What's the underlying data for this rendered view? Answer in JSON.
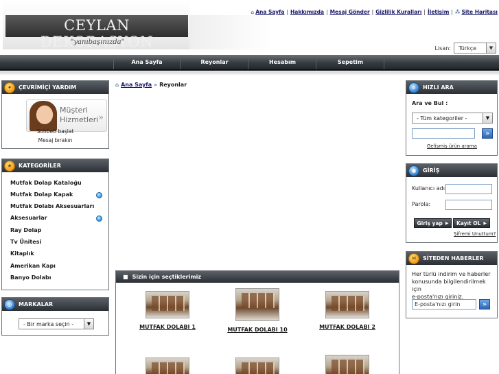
{
  "header": {
    "logo_text": "CEYLAN DEKORASYON",
    "slogan": "\"yanıbaşınızda\"",
    "top_links": [
      "Ana Sayfa",
      "Hakkımızda",
      "Mesaj Gönder",
      "Gizlilik Kuralları",
      "İletişim",
      "Site Haritası"
    ],
    "language_label": "Lisan:",
    "language_value": "Türkçe"
  },
  "nav": {
    "items": [
      "Ana Sayfa",
      "Reyonlar",
      "Hesabım",
      "Sepetim"
    ]
  },
  "support": {
    "title": "ÇEVRİMİÇİ YARDIM",
    "banner_line1": "Müşteri",
    "banner_line2": "Hizmetleri",
    "link_chat": "Sohbeti başlat",
    "link_message": "Mesaj bırakın"
  },
  "categories": {
    "title": "KATEGORİLER",
    "items": [
      "Mutfak Dolap Kataloğu",
      "Mutfak Dolap Kapak",
      "Mutfak Dolabı Aksesuarları",
      "Aksesuarlar",
      "Ray Dolap",
      "Tv Ünitesi",
      "Kitaplık",
      "Amerikan Kapı",
      "Banyo Dolabı"
    ]
  },
  "brands": {
    "title": "MARKALAR",
    "select_value": "- Bir marka seçin -"
  },
  "breadcrumb": {
    "home": "Ana Sayfa",
    "current": "Reyonlar"
  },
  "featured": {
    "title": "Sizin için seçtiklerimiz",
    "products": [
      "MUTFAK DOLABI 1",
      "MUTFAK DOLABI 10",
      "MUTFAK DOLABI 2"
    ]
  },
  "quick_search": {
    "title": "HIZLI ARA",
    "subtitle": "Ara ve Bul :",
    "category_value": "- Tüm kategoriler -",
    "advanced_link": "Gelişmiş ürün arama"
  },
  "login": {
    "title": "GİRİŞ",
    "username_label": "Kullanıcı adı:",
    "password_label": "Parola:",
    "login_button": "Giriş yap",
    "register_button": "Kayıt OL",
    "forgot_link": "Şifremi Unuttum?"
  },
  "news": {
    "title": "SİTEDEN HABERLER",
    "text_lines": [
      "Her türlü indirim ve haberler",
      "konusunda bilgilendirilmek için",
      "e-posta'nızı giriniz."
    ],
    "email_placeholder": "E-posta'nızı girin"
  }
}
